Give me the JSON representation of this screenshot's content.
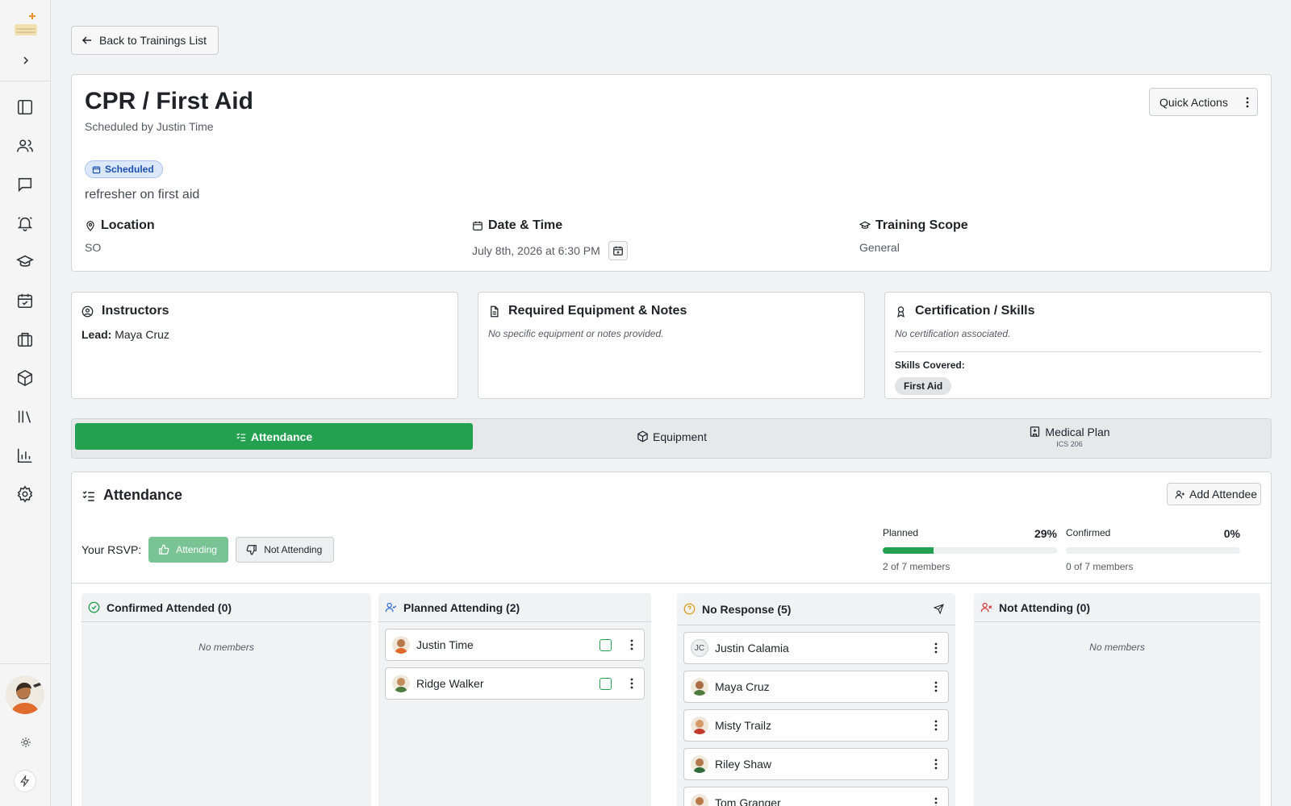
{
  "nav": {
    "items": [
      "sidebar-panel-icon",
      "team-icon",
      "messages-icon",
      "alerts-icon",
      "training-icon",
      "calendar-check-icon",
      "briefcase-icon",
      "package-icon",
      "library-icon",
      "reports-icon",
      "settings-icon"
    ]
  },
  "back_label": "Back to Trainings List",
  "training": {
    "title": "CPR / First Aid",
    "scheduled_by": "Scheduled by Justin Time",
    "quick_actions": "Quick Actions",
    "status": "Scheduled",
    "description": "refresher on first aid",
    "location_label": "Location",
    "location_value": "SO",
    "datetime_label": "Date & Time",
    "datetime_value": "July 8th, 2026 at 6:30 PM",
    "scope_label": "Training Scope",
    "scope_value": "General"
  },
  "instructors": {
    "title": "Instructors",
    "lead_label": "Lead:",
    "lead_name": "Maya Cruz"
  },
  "equipment_notes": {
    "title": "Required Equipment & Notes",
    "body": "No specific equipment or notes provided."
  },
  "certification": {
    "title": "Certification / Skills",
    "body": "No certification associated.",
    "skills_label": "Skills Covered:",
    "skills": [
      "First Aid"
    ]
  },
  "tabs": [
    {
      "label": "Attendance",
      "sub": "",
      "active": true
    },
    {
      "label": "Equipment",
      "sub": "",
      "active": false
    },
    {
      "label": "Medical Plan",
      "sub": "ICS 206",
      "active": false
    }
  ],
  "attendance": {
    "title": "Attendance",
    "add_label": "Add Attendee",
    "rsvp_label": "Your RSVP:",
    "rsvp_yes": "Attending",
    "rsvp_no": "Not Attending",
    "planned": {
      "label": "Planned",
      "pct_text": "29%",
      "fraction": 0.29,
      "sub": "2 of 7 members"
    },
    "confirmed": {
      "label": "Confirmed",
      "pct_text": "0%",
      "fraction": 0,
      "sub": "0 of 7 members"
    },
    "columns": {
      "confirmed": {
        "title": "Confirmed Attended (0)",
        "empty": "No members"
      },
      "planned": {
        "title": "Planned Attending (2)",
        "members": [
          "Justin Time",
          "Ridge Walker"
        ]
      },
      "noresponse": {
        "title": "No Response (5)",
        "members": [
          "Justin Calamia",
          "Maya Cruz",
          "Misty Trailz",
          "Riley Shaw",
          "Tom Granger"
        ],
        "initials": "JC"
      },
      "notattending": {
        "title": "Not Attending (0)",
        "empty": "No members"
      }
    }
  },
  "colors": {
    "accent": "#23a150",
    "status_blue": "#1d4fb0",
    "danger": "#d23a3a",
    "warn": "#d99a1c"
  }
}
